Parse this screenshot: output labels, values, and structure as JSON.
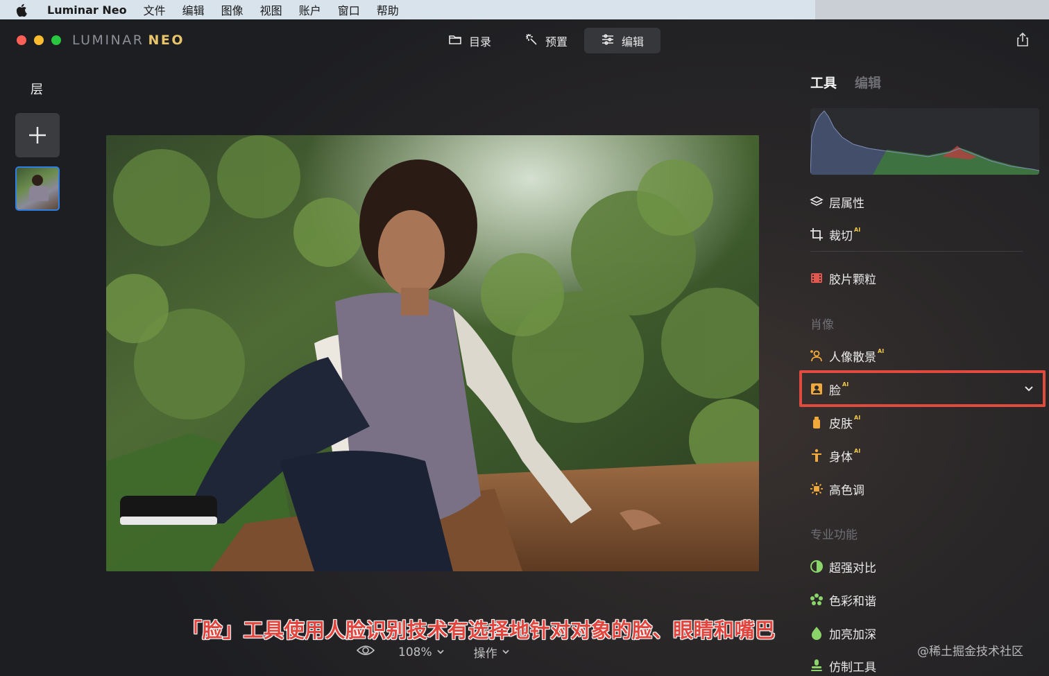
{
  "menubar": {
    "apple_icon": "apple-icon",
    "app_name": "Luminar Neo",
    "items": [
      "文件",
      "编辑",
      "图像",
      "视图",
      "账户",
      "窗口",
      "帮助"
    ]
  },
  "window": {
    "logo_left": "LUMINAR",
    "logo_right": "NEO",
    "modes": [
      {
        "label": "目录",
        "icon": "folder-icon",
        "active": false
      },
      {
        "label": "预置",
        "icon": "magic-wand-icon",
        "active": false
      },
      {
        "label": "编辑",
        "icon": "sliders-icon",
        "active": true
      }
    ],
    "share_icon": "share-icon"
  },
  "layers": {
    "title": "层",
    "add_icon": "plus-icon"
  },
  "caption": "「脸」工具使用人脸识别技术有选择地针对对象的脸、眼睛和嘴巴",
  "bottom": {
    "eye_icon": "eye-icon",
    "zoom": "108%",
    "ops": "操作"
  },
  "panel": {
    "tabs": [
      "工具",
      "编辑"
    ],
    "active_tab": "工具",
    "tools_top": [
      {
        "label": "层属性",
        "icon": "layers-icon",
        "ai": false
      },
      {
        "label": "裁切",
        "icon": "crop-icon",
        "ai": true
      }
    ],
    "film_grain": {
      "label": "胶片颗粒",
      "icon": "film-icon"
    },
    "portrait_section": "肖像",
    "portrait_tools": [
      {
        "label": "人像散景",
        "icon": "portrait-bokeh-icon",
        "ai": true
      },
      {
        "label": "脸",
        "icon": "face-icon",
        "ai": true,
        "highlighted": true
      },
      {
        "label": "皮肤",
        "icon": "skin-icon",
        "ai": true
      },
      {
        "label": "身体",
        "icon": "body-icon",
        "ai": true
      },
      {
        "label": "高色调",
        "icon": "high-key-icon",
        "ai": false
      }
    ],
    "pro_section": "专业功能",
    "pro_tools": [
      {
        "label": "超强对比",
        "icon": "contrast-icon"
      },
      {
        "label": "色彩和谐",
        "icon": "color-harmony-icon"
      },
      {
        "label": "加亮加深",
        "icon": "dodge-burn-icon"
      },
      {
        "label": "仿制工具",
        "icon": "clone-icon"
      }
    ],
    "ai_badge": "AI"
  },
  "watermark": "@稀土掘金技术社区",
  "colors": {
    "accent_blue": "#2f7de0",
    "highlight_red": "#e04a3f",
    "ai_badge": "#f0c84a",
    "neo_gold": "#e9c46a"
  }
}
